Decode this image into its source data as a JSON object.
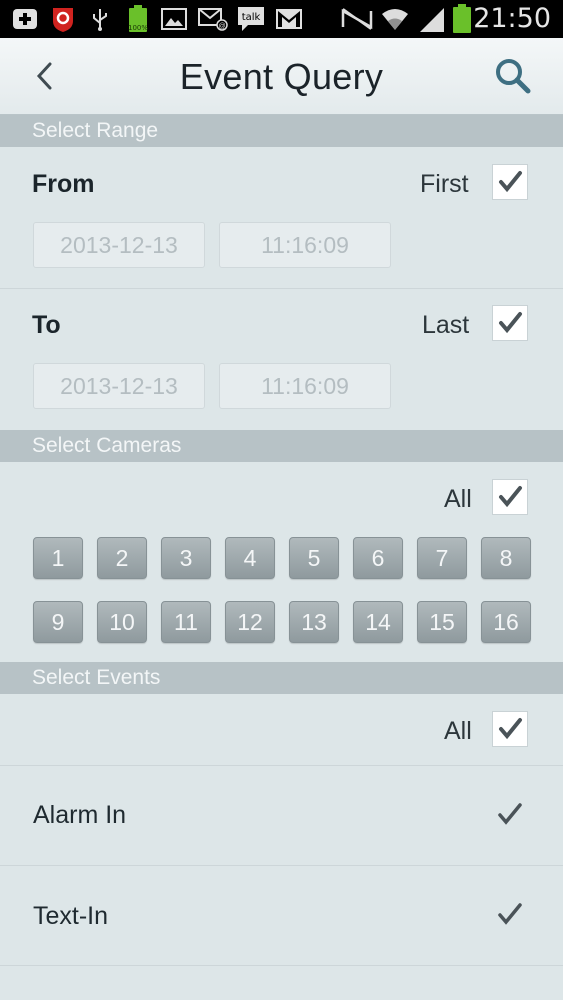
{
  "status_bar": {
    "time": "21:50",
    "battery_small_label": "100%",
    "talk_label": "talk",
    "icons": [
      "add-icon",
      "shield-app-icon",
      "usb-icon",
      "battery-full-icon",
      "image-icon",
      "email-icon",
      "talk-icon",
      "gmail-icon",
      "nfc-icon",
      "wifi-icon",
      "signal-icon",
      "battery-icon"
    ]
  },
  "header": {
    "title": "Event Query",
    "back_icon": "back-chevron-icon",
    "search_icon": "search-icon"
  },
  "range": {
    "section_title": "Select Range",
    "from": {
      "label": "From",
      "option_label": "First",
      "checked": true,
      "date": "2013-12-13",
      "time": "11:16:09"
    },
    "to": {
      "label": "To",
      "option_label": "Last",
      "checked": true,
      "date": "2013-12-13",
      "time": "11:16:09"
    }
  },
  "cameras": {
    "section_title": "Select Cameras",
    "all_label": "All",
    "all_checked": true,
    "buttons": [
      "1",
      "2",
      "3",
      "4",
      "5",
      "6",
      "7",
      "8",
      "9",
      "10",
      "11",
      "12",
      "13",
      "14",
      "15",
      "16"
    ]
  },
  "events": {
    "section_title": "Select Events",
    "all_label": "All",
    "all_checked": true,
    "items": [
      {
        "label": "Alarm In",
        "checked": true
      },
      {
        "label": "Text-In",
        "checked": true
      }
    ]
  },
  "colors": {
    "background": "#dde6e8",
    "section_header": "#b7c2c6",
    "camera_button": "#9aa4a8",
    "check_mark": "#4a5358"
  }
}
